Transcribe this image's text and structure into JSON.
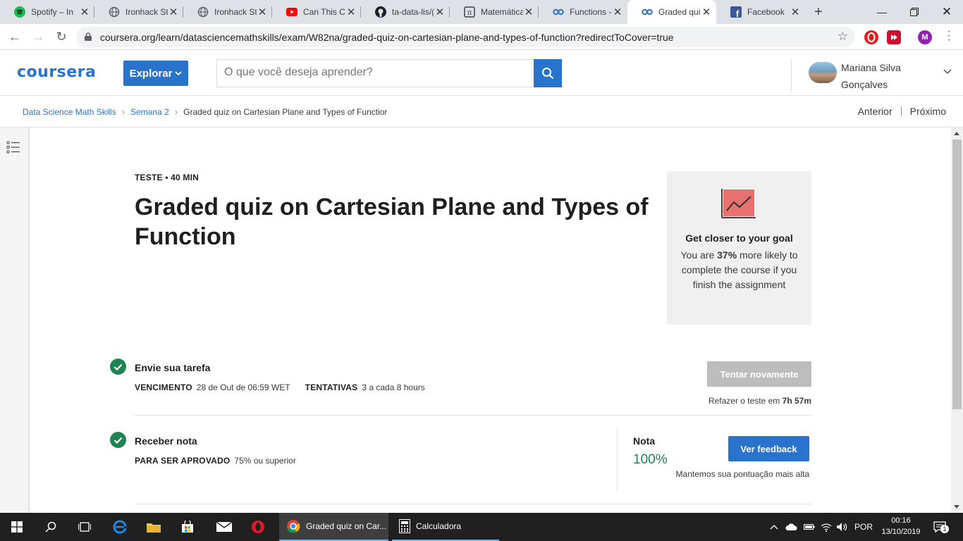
{
  "browser": {
    "tabs": [
      {
        "title": "Spotify – In",
        "icon": "spotify-icon"
      },
      {
        "title": "Ironhack St",
        "icon": "globe-icon"
      },
      {
        "title": "Ironhack St",
        "icon": "globe-icon"
      },
      {
        "title": "Can This Ch",
        "icon": "youtube-icon"
      },
      {
        "title": "ta-data-lis/(",
        "icon": "github-icon"
      },
      {
        "title": "Matemática",
        "icon": "math-icon"
      },
      {
        "title": "Functions -",
        "icon": "coursera-icon"
      },
      {
        "title": "Graded qui",
        "icon": "coursera-icon",
        "active": true
      },
      {
        "title": "Facebook",
        "icon": "facebook-icon"
      }
    ],
    "url": "coursera.org/learn/datasciencemathskills/exam/W82na/graded-quiz-on-cartesian-plane-and-types-of-function?redirectToCover=true",
    "profile_initial": "M"
  },
  "header": {
    "logo": "coursera",
    "explore_label": "Explorar",
    "search_placeholder": "O que você deseja aprender?",
    "user_name": "Mariana Silva Gonçalves"
  },
  "breadcrumb": {
    "course": "Data Science Math Skills",
    "week": "Semana 2",
    "current": "Graded quiz on Cartesian Plane and Types of Functior",
    "prev": "Anterior",
    "next": "Próximo"
  },
  "quiz": {
    "kicker": "TESTE • 40 MIN",
    "title": "Graded quiz on Cartesian Plane and Types of Function"
  },
  "goal_card": {
    "title": "Get closer to your goal",
    "text_before": "You are ",
    "percent": "37%",
    "text_after": " more likely to complete the course if you finish the assignment"
  },
  "submit_step": {
    "title": "Envie sua tarefa",
    "due_label": "VENCIMENTO",
    "due_value": "28 de Out de 06:59 WET",
    "attempts_label": "TENTATIVAS",
    "attempts_value": "3 a cada 8 hours",
    "retry_label": "Tentar novamente",
    "retry_note_prefix": "Refazer o teste em ",
    "retry_note_time": "7h 57m"
  },
  "grade_step": {
    "title": "Receber nota",
    "pass_label": "PARA SER APROVADO",
    "pass_value": "75% ou superior",
    "grade_label": "Nota",
    "grade_value": "100%",
    "feedback_label": "Ver feedback",
    "grade_note": "Mantemos sua pontuação mais alta"
  },
  "taskbar": {
    "chrome_app": "Graded quiz on Car...",
    "calc_app": "Calculadora",
    "lang": "POR",
    "time": "00:16",
    "date": "13/10/2019",
    "notifications": "1"
  },
  "colors": {
    "accent": "#2a73cc",
    "success": "#1f8354",
    "disabled": "#bdbdbd"
  }
}
